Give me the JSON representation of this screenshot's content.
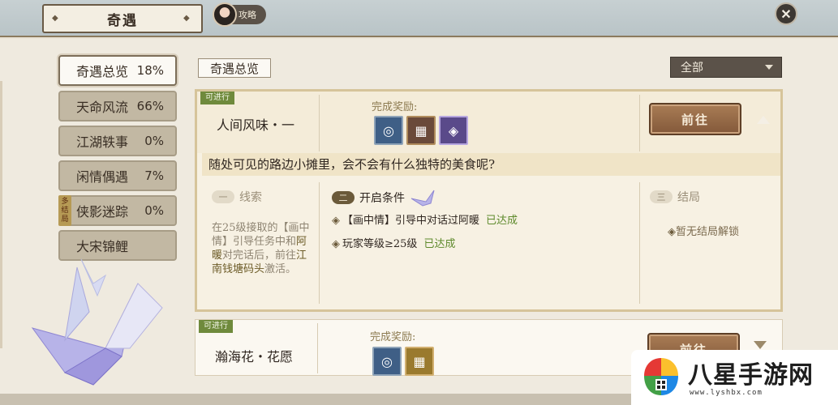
{
  "header": {
    "title": "奇遇",
    "guide_label": "攻略",
    "close_icon": "close-icon"
  },
  "sidebar": {
    "items": [
      {
        "label": "奇遇总览",
        "pct": "18%"
      },
      {
        "label": "天命风流",
        "pct": "66%"
      },
      {
        "label": "江湖轶事",
        "pct": "0%"
      },
      {
        "label": "闲情偶遇",
        "pct": "7%"
      },
      {
        "label": "侠影迷踪",
        "pct": "0%"
      },
      {
        "label": "大宋锦鲤",
        "pct": ""
      }
    ],
    "multi_tag": "多结局"
  },
  "main": {
    "section_tab": "奇遇总览",
    "filter_value": "全部",
    "quests": [
      {
        "status": "可进行",
        "title": "人间风味・一",
        "reward_label": "完成奖励:",
        "go_label": "前往",
        "description": "随处可见的路边小摊里，会不会有什么独特的美食呢?",
        "clue_badge": "一",
        "clue_head": "线索",
        "clue_text_1": "在25级接取的【画中情】引导任务中和",
        "clue_text_hl": "阿暖",
        "clue_text_2": "对完话后，前往",
        "clue_text_hl2": "江南钱塘码头",
        "clue_text_3": "激活。",
        "cond_badge": "二",
        "cond_head": "开启条件",
        "conditions": [
          {
            "text": "【画中情】引导中对话过阿暖",
            "state": "已达成"
          },
          {
            "text": "玩家等级≥25级",
            "state": "已达成"
          }
        ],
        "ending_badge": "三",
        "ending_head": "结局",
        "ending_text": "暂无结局解锁"
      },
      {
        "status": "可进行",
        "title": "瀚海花・花愿",
        "reward_label": "完成奖励:",
        "go_label": "前往"
      }
    ]
  },
  "watermark": {
    "brand": "八星手游网",
    "url": "www.lyshbx.com"
  },
  "colors": {
    "accent_green": "#6f8a3c",
    "button_brown": "#8f6442",
    "achieved_green": "#5e8a2c"
  }
}
